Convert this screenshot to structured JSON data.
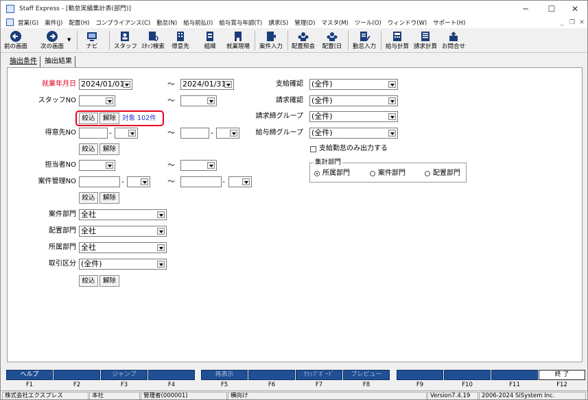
{
  "window": {
    "title": "Staff Express - [勤怠実績集計表(部門)]",
    "minimize": "─",
    "maximize": "☐",
    "close": "✕"
  },
  "menu": [
    "営業(G)",
    "案件(J)",
    "配置(H)",
    "コンプライアンス(C)",
    "勤怠(N)",
    "給与前払(I)",
    "給与賞与年調(T)",
    "請求(S)",
    "管理(D)",
    "マスタ(M)",
    "ツール(O)",
    "ウィンドウ(W)",
    "サポート(H)"
  ],
  "toolbar": {
    "prev": "前の画面",
    "next": "次の画面",
    "navi": "ナビ",
    "staff": "スタッフ",
    "staff_search": "ｽﾀｯﾌ検索",
    "client": "得意先",
    "org": "組織",
    "site": "就業現場",
    "case_input": "案件入力",
    "assign_ref": "配置照会",
    "assign_day": "配置(日",
    "attend_input": "勤怠入力",
    "payroll": "給与計算",
    "billing": "請求計算",
    "inquiry": "お問合せ"
  },
  "tabs": [
    "抽出条件",
    "抽出結果"
  ],
  "form": {
    "work_ym_label": "就業年月日",
    "date_from": "2024/01/01",
    "date_to": "2024/01/31",
    "tilde": "～",
    "staff_no_label": "スタッフNO",
    "filter": "絞込",
    "clear": "解除",
    "target_count": "対象 102件",
    "client_no_label": "得意先NO",
    "manager_no_label": "担当者NO",
    "case_mgmt_no_label": "案件管理NO",
    "dash": "-",
    "case_dept_label": "案件部門",
    "case_dept_value": "全社",
    "assign_dept_label": "配置部門",
    "assign_dept_value": "全社",
    "belong_dept_label": "所属部門",
    "belong_dept_value": "全社",
    "trade_type_label": "取引区分",
    "trade_type_value": "(全件)",
    "pay_confirm_label": "支給確認",
    "pay_confirm_value": "(全件)",
    "bill_confirm_label": "請求確認",
    "bill_confirm_value": "(全件)",
    "bill_group_label": "請求締グループ",
    "bill_group_value": "(全件)",
    "pay_group_label": "給与締グループ",
    "pay_group_value": "(全件)",
    "only_paid_label": "支給勤怠のみ出力する",
    "agg_dept_title": "集計部門",
    "agg_opt1": "所属部門",
    "agg_opt2": "案件部門",
    "agg_opt3": "配置部門"
  },
  "fkeys": {
    "f1": "ヘルプ",
    "f3": "ジャンプ",
    "f5": "再表示",
    "f7": "ｸﾘｯﾌﾟﾎﾞｰﾄﾞ",
    "f8": "プレビュー",
    "f12": "終 了",
    "labels": [
      "F1",
      "F2",
      "F3",
      "F4",
      "F5",
      "F6",
      "F7",
      "F8",
      "F9",
      "F10",
      "F11",
      "F12"
    ]
  },
  "status": {
    "company": "株式会社エクスプレス",
    "branch": "本社",
    "user": "管理者(000001)",
    "mode": "横向け",
    "version": "Version7.4.19",
    "copyright": "2006-2024 SiSystem Inc."
  }
}
